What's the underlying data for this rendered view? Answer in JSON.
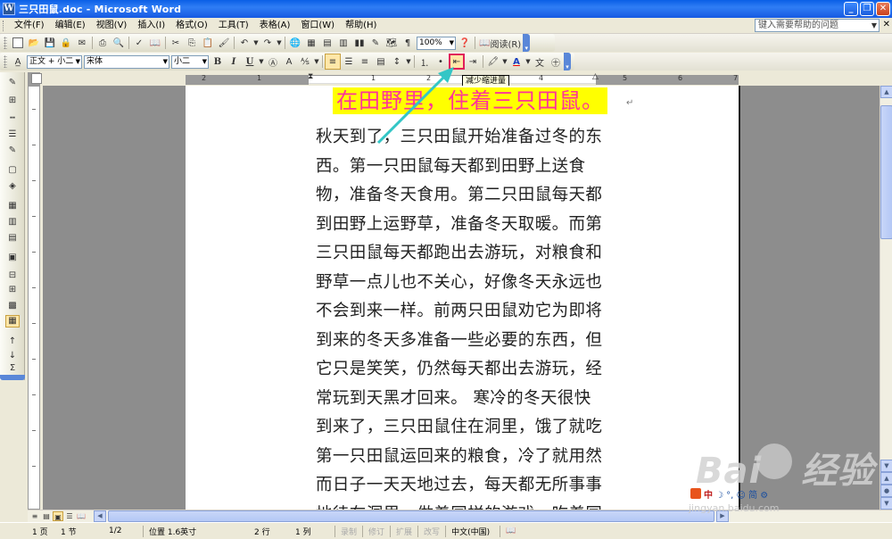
{
  "window": {
    "title": "三只田鼠.doc - Microsoft Word",
    "app_icon_letter": "W",
    "min_glyph": "_",
    "max_glyph": "❐",
    "close_glyph": "✕"
  },
  "menubar": {
    "items": [
      "文件(F)",
      "编辑(E)",
      "视图(V)",
      "插入(I)",
      "格式(O)",
      "工具(T)",
      "表格(A)",
      "窗口(W)",
      "帮助(H)"
    ],
    "help_placeholder": "键入需要帮助的问题",
    "doc_close": "✕"
  },
  "standard_toolbar": {
    "zoom": "100%",
    "reading_label": "阅读(R)"
  },
  "formatting_toolbar": {
    "style": "正文 + 小二",
    "font": "宋体",
    "size": "小二",
    "bold": "B",
    "italic": "I",
    "underline": "U"
  },
  "tooltip": "减少缩进量",
  "ruler_numbers": [
    "2",
    "1",
    "1",
    "2",
    "3",
    "4",
    "5",
    "6",
    "7"
  ],
  "document": {
    "heading": "在田野里，住着三只田鼠。",
    "lines": [
      "秋天到了，三只田鼠开始准备过冬的东",
      "西。第一只田鼠每天都到田野上送食",
      "物，准备冬天食用。第二只田鼠每天都",
      "到田野上运野草，准备冬天取暖。而第",
      "三只田鼠每天都跑出去游玩，对粮食和",
      "野草一点儿也不关心，好像冬天永远也",
      "不会到来一样。前两只田鼠劝它为即将",
      "到来的冬天多准备一些必要的东西，但",
      "它只是笑笑，仍然每天都出去游玩，经",
      "常玩到天黑才回来。 寒冷的冬天很快",
      "到来了，三只田鼠住在洞里，饿了就吃",
      "第一只田鼠运回来的粮食，冷了就用然",
      "而日子一天天地过去，每天都无所事事",
      "地待在洞里，做着同样的游戏，吃着同"
    ]
  },
  "statusbar": {
    "page": "1 页",
    "section": "1 节",
    "page_of": "1/2",
    "position": "位置 1.6英寸",
    "line": "2 行",
    "column": "1 列",
    "rec": "录制",
    "trk": "修订",
    "ext": "扩展",
    "ovr": "改写",
    "language": "中文(中国)"
  },
  "watermark": {
    "brand": "Bai",
    "brand2": "经验",
    "url": "jingyan.baidu.com",
    "ime_zh": "中",
    "ime_syms": "☽ °, ☺ 简 ⚙"
  },
  "colors": {
    "heading_text": "#ff3399",
    "heading_highlight": "#ffff00",
    "titlebar": "#0a5fe6",
    "annotation_arrow": "#33c6c6",
    "annotation_box": "#e0205a"
  }
}
